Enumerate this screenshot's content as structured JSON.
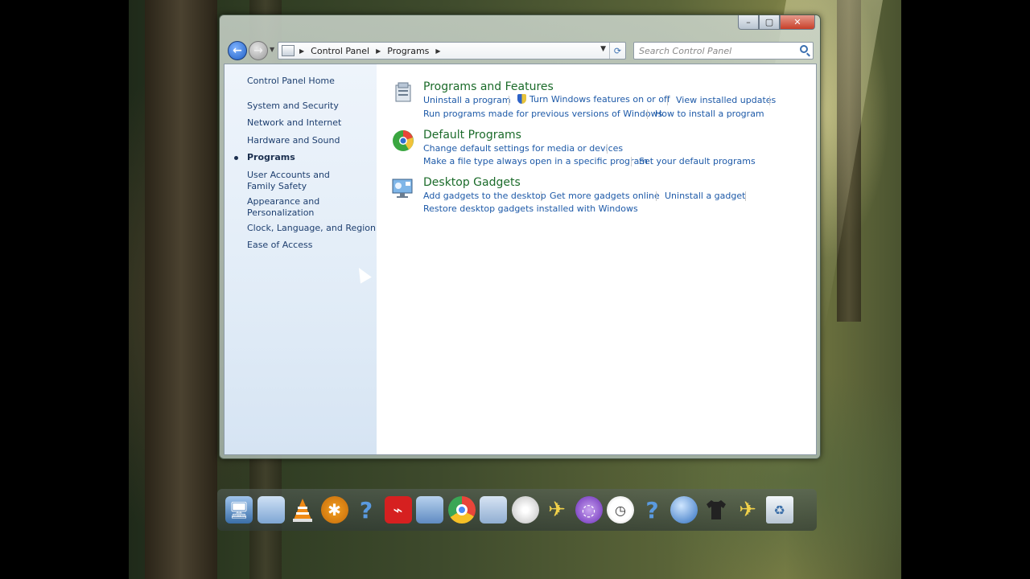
{
  "window": {
    "caption_buttons": [
      "minimize",
      "maximize",
      "close"
    ]
  },
  "navbar": {
    "breadcrumb": [
      "Control Panel",
      "Programs"
    ],
    "search_placeholder": "Search Control Panel"
  },
  "sidebar": {
    "home": "Control Panel Home",
    "items": [
      {
        "label": "System and Security",
        "current": false
      },
      {
        "label": "Network and Internet",
        "current": false
      },
      {
        "label": "Hardware and Sound",
        "current": false
      },
      {
        "label": "Programs",
        "current": true
      },
      {
        "label": "User Accounts and Family Safety",
        "current": false
      },
      {
        "label": "Appearance and Personalization",
        "current": false
      },
      {
        "label": "Clock, Language, and Region",
        "current": false
      },
      {
        "label": "Ease of Access",
        "current": false
      }
    ]
  },
  "categories": [
    {
      "title": "Programs and Features",
      "icon": "programs-features-icon",
      "tasks": [
        "Uninstall a program",
        "Turn Windows features on or off",
        "View installed updates",
        "Run programs made for previous versions of Windows",
        "How to install a program"
      ]
    },
    {
      "title": "Default Programs",
      "icon": "default-programs-icon",
      "tasks": [
        "Change default settings for media or devices",
        "Make a file type always open in a specific program",
        "Set your default programs"
      ]
    },
    {
      "title": "Desktop Gadgets",
      "icon": "desktop-gadgets-icon",
      "tasks": [
        "Add gadgets to the desktop",
        "Get more gadgets online",
        "Uninstall a gadget",
        "Restore desktop gadgets installed with Windows"
      ]
    }
  ],
  "dock": {
    "icons": [
      "computer-icon",
      "folder-icon",
      "vlc-icon",
      "avast-icon",
      "help-icon",
      "acrobat-icon",
      "folder-icon",
      "chrome-icon",
      "documents-icon",
      "disc-icon",
      "airplane-icon",
      "bittorrent-icon",
      "clock-icon",
      "help-icon",
      "network-globe-icon",
      "tshirt-icon",
      "airplane-icon",
      "recycle-bin-icon"
    ]
  },
  "colors": {
    "category_title": "#1b6b2a",
    "task_link": "#1e5aa8",
    "sidebar_link": "#1e3f6f"
  }
}
